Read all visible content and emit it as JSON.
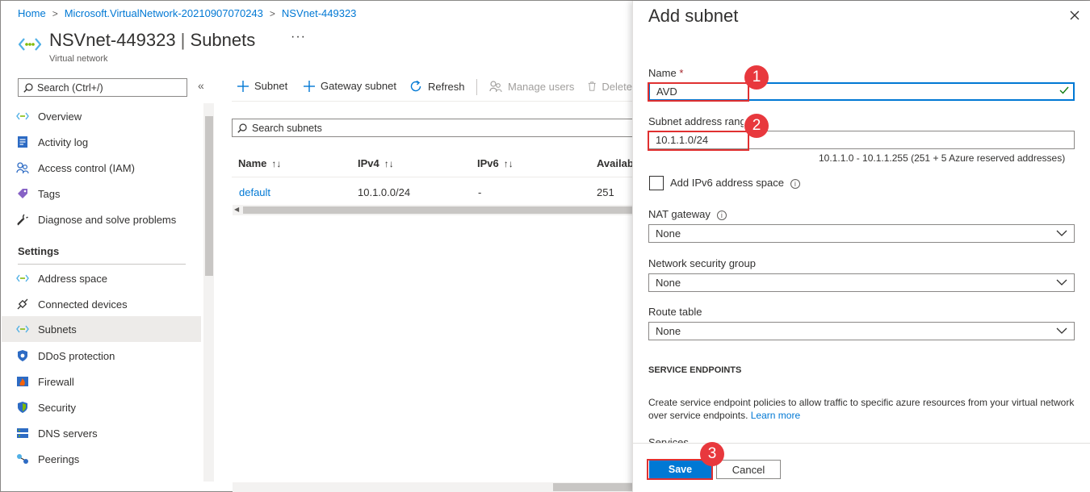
{
  "breadcrumb": [
    "Home",
    "Microsoft.VirtualNetwork-20210907070243",
    "NSVnet-449323"
  ],
  "page": {
    "title_resource": "NSVnet-449323",
    "title_section": "Subnets",
    "subtitle": "Virtual network",
    "more": "···"
  },
  "sidebar": {
    "search_placeholder": "Search (Ctrl+/)",
    "collapse": "«",
    "items_top": [
      {
        "label": "Overview",
        "icon": "vnet-icon"
      },
      {
        "label": "Activity log",
        "icon": "activity-log-icon"
      },
      {
        "label": "Access control (IAM)",
        "icon": "people-icon"
      },
      {
        "label": "Tags",
        "icon": "tag-icon"
      },
      {
        "label": "Diagnose and solve problems",
        "icon": "wrench-icon"
      }
    ],
    "settings_heading": "Settings",
    "items_settings": [
      {
        "label": "Address space",
        "icon": "vnet-icon"
      },
      {
        "label": "Connected devices",
        "icon": "plug-icon"
      },
      {
        "label": "Subnets",
        "icon": "vnet-icon",
        "active": true
      },
      {
        "label": "DDoS protection",
        "icon": "shield-icon"
      },
      {
        "label": "Firewall",
        "icon": "firewall-icon"
      },
      {
        "label": "Security",
        "icon": "security-shield-icon"
      },
      {
        "label": "DNS servers",
        "icon": "dns-icon"
      },
      {
        "label": "Peerings",
        "icon": "peering-icon"
      }
    ]
  },
  "toolbar": {
    "add_subnet": "Subnet",
    "add_gateway_subnet": "Gateway subnet",
    "refresh": "Refresh",
    "manage_users": "Manage users",
    "delete": "Delete"
  },
  "subnet_search": {
    "placeholder": "Search subnets"
  },
  "table": {
    "columns": [
      "Name",
      "IPv4",
      "IPv6",
      "Available"
    ],
    "sort_glyph": "↑↓",
    "rows": [
      {
        "name": "default",
        "ipv4": "10.1.0.0/24",
        "ipv6": "-",
        "available": "251"
      }
    ]
  },
  "panel": {
    "title": "Add subnet",
    "name_label": "Name",
    "required_mark": "*",
    "name_value": "AVD",
    "range_label": "Subnet address range",
    "range_value": "10.1.1.0/24",
    "range_hint": "10.1.1.0 - 10.1.1.255 (251 + 5 Azure reserved addresses)",
    "ipv6_label": "Add IPv6 address space",
    "info_glyph": "i",
    "nat_label": "NAT gateway",
    "nat_value": "None",
    "nsg_label": "Network security group",
    "nsg_value": "None",
    "route_label": "Route table",
    "route_value": "None",
    "service_endpoints_heading": "SERVICE ENDPOINTS",
    "service_desc": "Create service endpoint policies to allow traffic to specific azure resources from your virtual network over service endpoints.",
    "learn_more": "Learn more",
    "services_label": "Services",
    "save": "Save",
    "cancel": "Cancel"
  },
  "annotations": [
    "1",
    "2",
    "3"
  ],
  "colors": {
    "accent": "#0078d4",
    "annotation": "#e8383d",
    "link": "#0078d4"
  }
}
